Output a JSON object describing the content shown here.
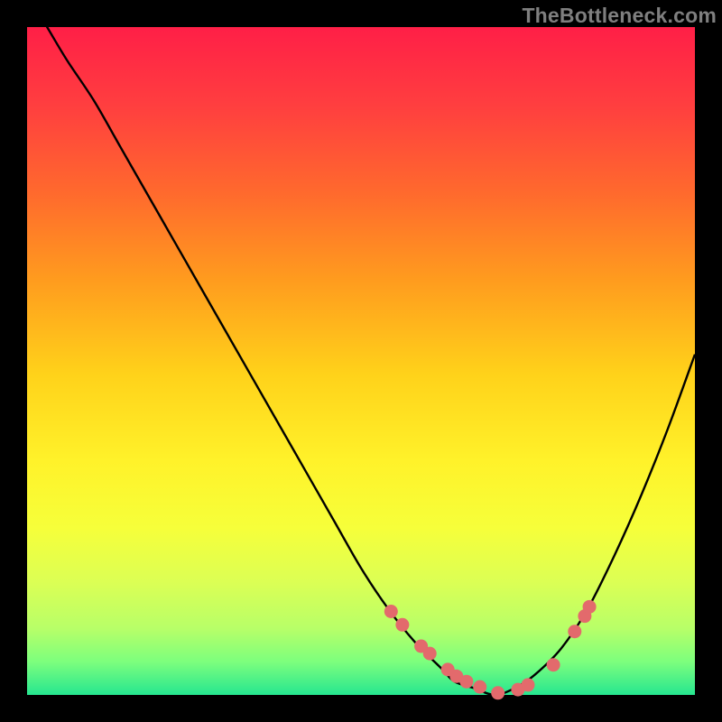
{
  "watermark": "TheBottleneck.com",
  "chart_data": {
    "type": "line",
    "title": "",
    "xlabel": "",
    "ylabel": "",
    "xlim": [
      0,
      100
    ],
    "ylim": [
      0,
      100
    ],
    "series": [
      {
        "name": "bottleneck-curve",
        "x": [
          0,
          3,
          6,
          10,
          14,
          18,
          22,
          26,
          30,
          34,
          38,
          42,
          46,
          50,
          54,
          58,
          62,
          64,
          67,
          70,
          73,
          76,
          80,
          84,
          88,
          92,
          96,
          100
        ],
        "y": [
          105,
          100,
          95,
          89,
          82,
          75,
          68,
          61,
          54,
          47,
          40,
          33,
          26,
          19,
          13,
          8,
          4,
          2,
          1,
          0,
          1,
          3,
          7,
          13,
          21,
          30,
          40,
          51
        ]
      }
    ],
    "markers": {
      "name": "highlight-dots",
      "x": [
        54.5,
        56.2,
        59.0,
        60.3,
        63.0,
        64.3,
        65.8,
        67.8,
        70.5,
        73.5,
        75.0,
        78.8,
        82.0,
        83.5,
        84.2
      ],
      "y": [
        12.5,
        10.5,
        7.3,
        6.2,
        3.8,
        2.8,
        2.0,
        1.2,
        0.3,
        0.8,
        1.5,
        4.5,
        9.5,
        11.8,
        13.2
      ]
    },
    "background": "red-yellow-green vertical gradient"
  }
}
